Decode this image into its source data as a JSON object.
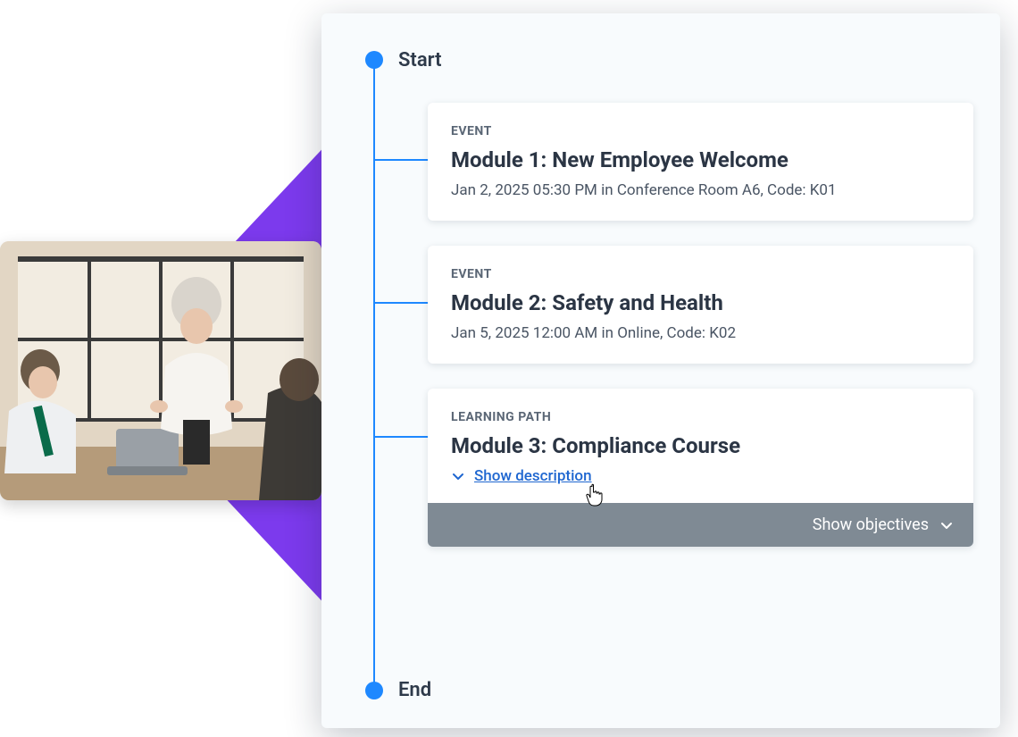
{
  "timeline": {
    "start_label": "Start",
    "end_label": "End"
  },
  "cards": [
    {
      "tag": "EVENT",
      "title": "Module 1: New Employee Welcome",
      "meta": "Jan 2, 2025 05:30 PM in Conference Room A6, Code: K01"
    },
    {
      "tag": "EVENT",
      "title": "Module 2: Safety and Health",
      "meta": "Jan 5, 2025 12:00 AM in Online, Code: K02"
    },
    {
      "tag": "LEARNING PATH",
      "title": "Module 3: Compliance Course",
      "show_description": "Show description",
      "show_objectives": "Show objectives"
    }
  ]
}
